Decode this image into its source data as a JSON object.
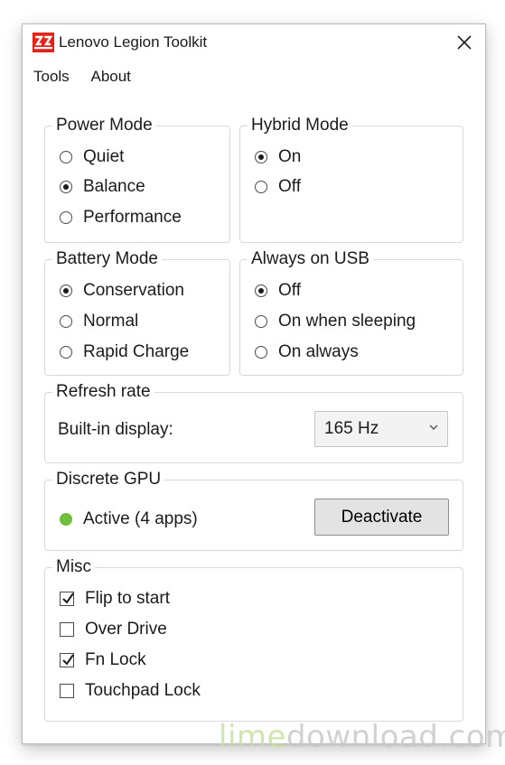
{
  "app": {
    "title": "Lenovo Legion Toolkit",
    "logo_icon": "legion-logo",
    "close_icon": "close-icon"
  },
  "menu": {
    "items": [
      "Tools",
      "About"
    ]
  },
  "power_mode": {
    "title": "Power Mode",
    "options": [
      {
        "label": "Quiet",
        "checked": false
      },
      {
        "label": "Balance",
        "checked": true
      },
      {
        "label": "Performance",
        "checked": false
      }
    ]
  },
  "hybrid_mode": {
    "title": "Hybrid Mode",
    "options": [
      {
        "label": "On",
        "checked": true
      },
      {
        "label": "Off",
        "checked": false
      }
    ]
  },
  "battery_mode": {
    "title": "Battery Mode",
    "options": [
      {
        "label": "Conservation",
        "checked": true
      },
      {
        "label": "Normal",
        "checked": false
      },
      {
        "label": "Rapid Charge",
        "checked": false
      }
    ]
  },
  "always_on_usb": {
    "title": "Always on USB",
    "options": [
      {
        "label": "Off",
        "checked": true
      },
      {
        "label": "On when sleeping",
        "checked": false
      },
      {
        "label": "On always",
        "checked": false
      }
    ]
  },
  "refresh_rate": {
    "title": "Refresh rate",
    "label": "Built-in display:",
    "selected": "165 Hz"
  },
  "discrete_gpu": {
    "title": "Discrete GPU",
    "status": "Active (4 apps)",
    "status_color": "#6fbf3f",
    "button": "Deactivate"
  },
  "misc": {
    "title": "Misc",
    "options": [
      {
        "label": "Flip to start",
        "checked": true
      },
      {
        "label": "Over Drive",
        "checked": false
      },
      {
        "label": "Fn Lock",
        "checked": true
      },
      {
        "label": "Touchpad Lock",
        "checked": false
      }
    ]
  },
  "watermark": {
    "part1": "lime",
    "part2": "download",
    "part3": ".com",
    "color1": "#c7e2a0",
    "color2": "#c9c9c9"
  }
}
